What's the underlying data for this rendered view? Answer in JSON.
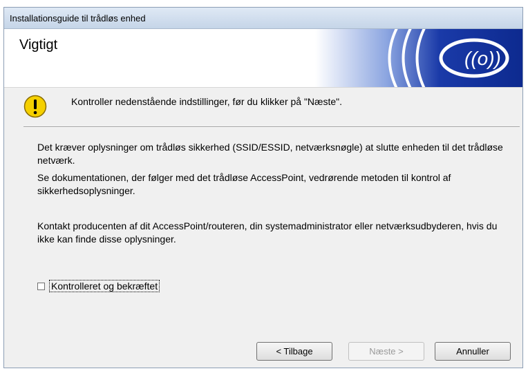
{
  "window": {
    "title": "Installationsguide til trådløs enhed"
  },
  "header": {
    "title": "Vigtigt",
    "logo_icon": "wireless-signal-icon"
  },
  "warning": {
    "icon": "warning-exclamation-icon",
    "text": "Kontroller nedenstående indstillinger, før du klikker på \"Næste\"."
  },
  "body": {
    "p1": "Det kræver oplysninger om trådløs sikkerhed (SSID/ESSID, netværksnøgle) at slutte enheden til det trådløse netværk.",
    "p2": "Se dokumentationen, der følger med det trådløse AccessPoint, vedrørende metoden til kontrol af sikkerhedsoplysninger.",
    "p3": "Kontakt producenten af dit AccessPoint/routeren, din systemadministrator eller netværksudbyderen, hvis du ikke kan finde disse oplysninger."
  },
  "checkbox": {
    "label": "Kontrolleret og bekræftet",
    "checked": false
  },
  "buttons": {
    "back": "< Tilbage",
    "next": "Næste >",
    "cancel": "Annuller",
    "next_enabled": false
  },
  "colors": {
    "header_blue": "#1a3aa8",
    "warning_yellow": "#f5d000"
  }
}
